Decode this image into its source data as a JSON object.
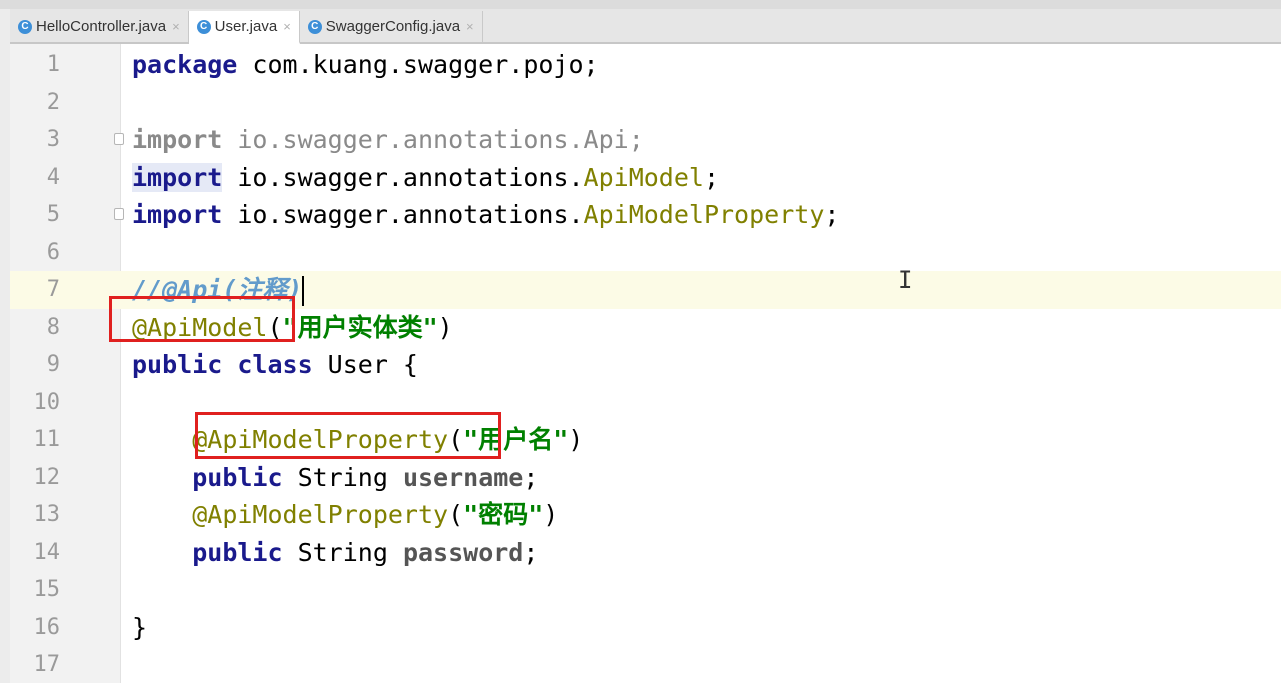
{
  "tabs": [
    {
      "label": "HelloController.java",
      "icon": "C",
      "active": false
    },
    {
      "label": "User.java",
      "icon": "C",
      "active": true
    },
    {
      "label": "SwaggerConfig.java",
      "icon": "C",
      "active": false
    }
  ],
  "tab_close_glyph": "×",
  "line_numbers": [
    "1",
    "2",
    "3",
    "4",
    "5",
    "6",
    "7",
    "8",
    "9",
    "10",
    "11",
    "12",
    "13",
    "14",
    "15",
    "16",
    "17"
  ],
  "code": {
    "l1": {
      "kw": "package",
      "rest": " com.kuang.swagger.pojo;"
    },
    "l3": {
      "kw": "import",
      "rest": " io.swagger.annotations.Api;"
    },
    "l4": {
      "kw": "import",
      "pkg": " io.swagger.annotations.",
      "cls": "ApiModel",
      "end": ";"
    },
    "l5": {
      "kw": "import",
      "pkg": " io.swagger.annotations.",
      "cls": "ApiModelProperty",
      "end": ";"
    },
    "l7": {
      "comment": "//@Api(注释)"
    },
    "l8": {
      "anno": "@ApiModel",
      "open": "(",
      "str": "\"用户实体类\"",
      "close": ")"
    },
    "l9": {
      "kw": "public class",
      "rest": " User {"
    },
    "l11": {
      "anno": "@ApiModelProperty",
      "open": "(",
      "str": "\"用户名\"",
      "close": ")"
    },
    "l12": {
      "kw": "public",
      "type": " String ",
      "field": "username",
      "end": ";"
    },
    "l13": {
      "anno": "@ApiModelProperty",
      "open": "(",
      "str": "\"密码\"",
      "close": ")"
    },
    "l14": {
      "kw": "public",
      "type": " String ",
      "field": "password",
      "end": ";"
    },
    "l16": {
      "rest": "}"
    }
  },
  "colors": {
    "keyword": "#1a1a8c",
    "annotation": "#808000",
    "string": "#008000",
    "comment": "#629bcb",
    "highlight_box": "#e0201f"
  }
}
